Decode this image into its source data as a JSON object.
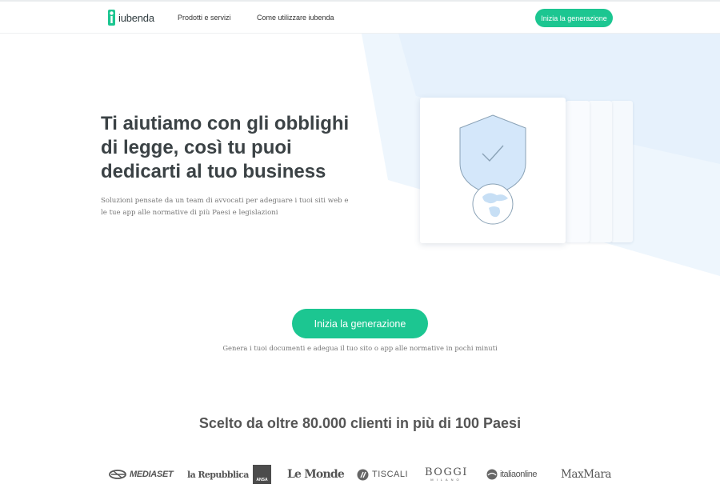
{
  "header": {
    "logo_text": "iubenda",
    "nav_items": [
      {
        "label": "Prodotti e servizi"
      },
      {
        "label": "Come utilizzare iubenda"
      }
    ],
    "cta_label": "Inizia la generazione"
  },
  "hero": {
    "headline_lines": [
      "Ti aiutiamo con gli obblighi",
      "di legge, così tu puoi",
      "dedicarti al tuo business"
    ],
    "subtext": "Soluzioni pensate da un team di avvocati per adeguare i tuoi siti web e le tue app alle normative di più Paesi e legislazioni",
    "illustration_icons": [
      "shield-check-icon",
      "globe-icon"
    ]
  },
  "cta_section": {
    "button_label": "Inizia la generazione",
    "note": "Genera i tuoi documenti e adegua il tuo sito o app alle normative in pochi minuti"
  },
  "clients": {
    "title": "Scelto da oltre 80.000 clienti in più di 100 Paesi",
    "logos": [
      {
        "name": "MEDIASET"
      },
      {
        "name": "la Repubblica"
      },
      {
        "name": "ANSA"
      },
      {
        "name": "Le Monde"
      },
      {
        "name": "TISCALI"
      },
      {
        "name": "BOGGI",
        "sub": "MILANO"
      },
      {
        "name": "italiaonline"
      },
      {
        "name": "MaxMara"
      }
    ]
  },
  "colors": {
    "accent": "#1cc691",
    "hero_background": "#eef6fd",
    "heading_text": "#3b4245",
    "body_text": "#777777"
  }
}
